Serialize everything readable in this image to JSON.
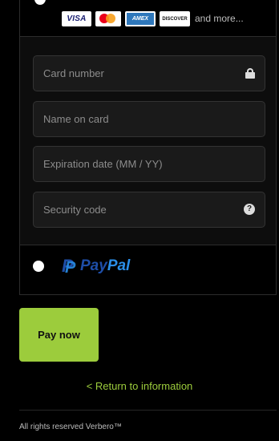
{
  "payment": {
    "brands": {
      "visa": "VISA",
      "amex": "AMEX",
      "discover": "DISCOVER",
      "more": "and more..."
    },
    "fields": {
      "card_number": "Card number",
      "name_on_card": "Name on card",
      "expiration": "Expiration date (MM / YY)",
      "security_code": "Security code"
    },
    "paypal": {
      "pay": "Pay",
      "pal": "Pal"
    }
  },
  "actions": {
    "pay_now": "Pay now",
    "return_link": "< Return to information"
  },
  "footer": {
    "text": "All rights reserved Verbero™"
  },
  "icons": [
    "lock-icon",
    "question-icon",
    "paypal-logo",
    "mastercard-logo"
  ],
  "colors": {
    "accent": "#9ccc3c",
    "background": "#000000",
    "field_bg": "#1a1a1a"
  }
}
